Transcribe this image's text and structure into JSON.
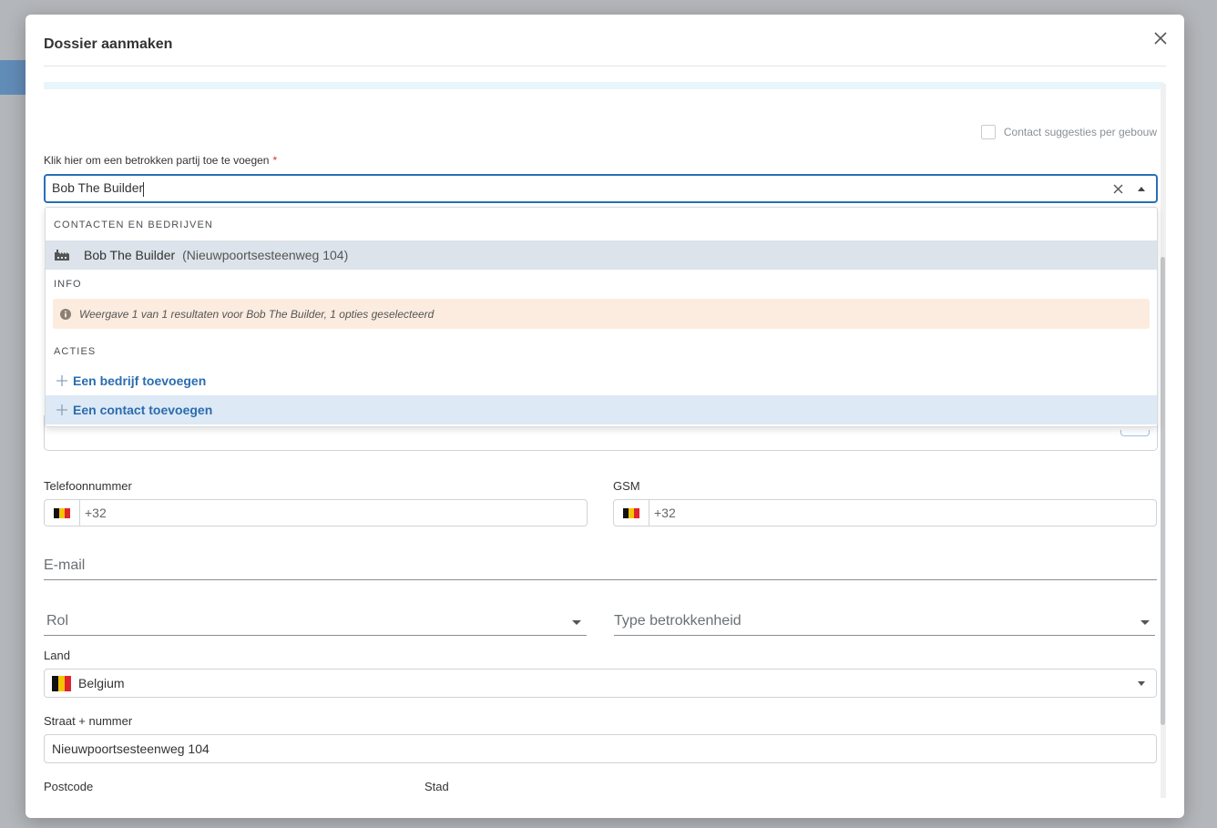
{
  "modal": {
    "title": "Dossier aanmaken"
  },
  "suggestions": {
    "label": "Contact suggesties per gebouw",
    "checked": false
  },
  "party": {
    "label": "Klik hier om een betrokken partij toe te voegen",
    "required_mark": "*",
    "value": "Bob The Builder"
  },
  "dropdown": {
    "group_contacts": "CONTACTEN EN BEDRIJVEN",
    "result": {
      "icon": "factory-icon",
      "name": "Bob The Builder",
      "address": "(Nieuwpoortsesteenweg 104)"
    },
    "group_info": "INFO",
    "info_icon": "info-circle-icon",
    "info_text": "Weergave 1 van 1 resultaten voor Bob The Builder, 1 opties geselecteerd",
    "group_actions": "ACTIES",
    "actions": [
      {
        "label": "Een bedrijf toevoegen",
        "icon": "plus-icon"
      },
      {
        "label": "Een contact toevoegen",
        "icon": "plus-icon"
      }
    ]
  },
  "phone": {
    "label": "Telefoonnummer",
    "prefix": "+32"
  },
  "gsm": {
    "label": "GSM",
    "prefix": "+32"
  },
  "email": {
    "placeholder": "E-mail"
  },
  "rol": {
    "placeholder": "Rol"
  },
  "type": {
    "placeholder": "Type betrokkenheid"
  },
  "land": {
    "label": "Land",
    "value": "Belgium"
  },
  "street": {
    "label": "Straat + nummer",
    "value": "Nieuwpoortsesteenweg 104"
  },
  "postcode": {
    "label": "Postcode"
  },
  "city": {
    "label": "Stad"
  },
  "colors": {
    "accent": "#2a6fb5",
    "action_text": "#2b6cb0",
    "info_bg": "#fcecdf",
    "selected_bg": "#dce3ea",
    "hover_bg": "#dde9f5",
    "required": "#d32f2f"
  }
}
